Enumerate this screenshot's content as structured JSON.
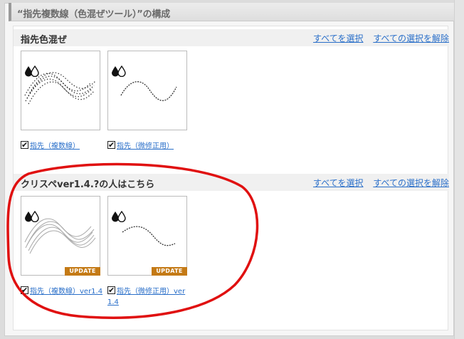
{
  "page": {
    "title": "“指先複数線（色混ぜツール）”の構成"
  },
  "sections": [
    {
      "title": "指先色混ぜ",
      "select_all": "すべてを選択",
      "deselect_all": "すべての選択を解除",
      "items": [
        {
          "label": "指先（複数線）",
          "checked": true,
          "badge": ""
        },
        {
          "label": "指先（微修正用）",
          "checked": true,
          "badge": ""
        }
      ]
    },
    {
      "title": "クリスペver1.4.?の人はこちら",
      "select_all": "すべてを選択",
      "deselect_all": "すべての選択を解除",
      "items": [
        {
          "label": "指先（複数線）ver1.4",
          "checked": true,
          "badge": "UPDATE"
        },
        {
          "label_line1": "指先（微修正用）ver",
          "label_line2": "1.4",
          "checked": true,
          "badge": "UPDATE"
        }
      ]
    }
  ],
  "colors": {
    "link": "#2a6fc9",
    "badge": "#c47a16",
    "highlight_oval": "#e01010"
  },
  "icons": [
    "blend-drops-icon",
    "checkbox-checked-icon"
  ]
}
